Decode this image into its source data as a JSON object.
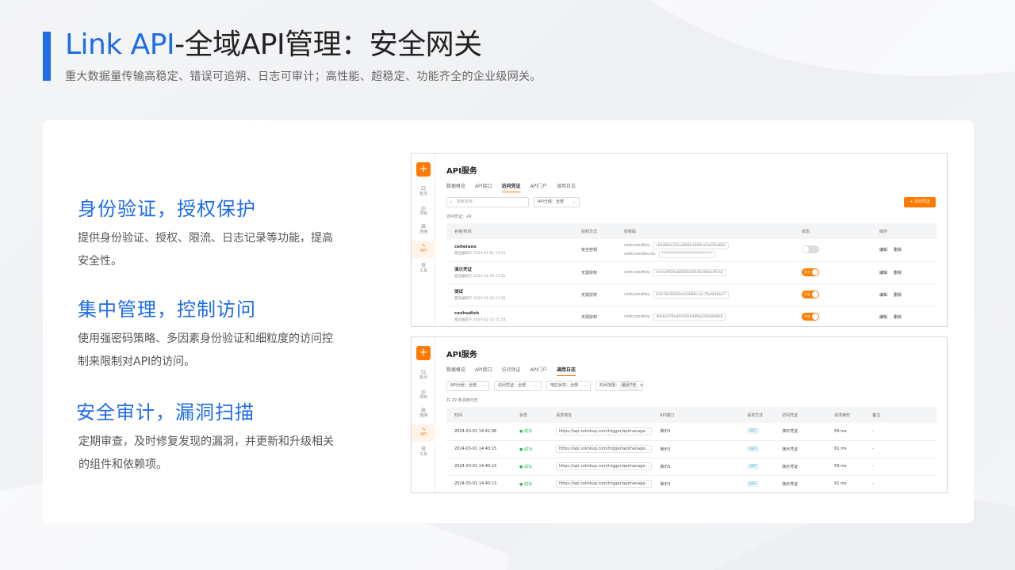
{
  "page": {
    "title_accent": "Link API",
    "title_rest": "-全域API管理：安全网关",
    "subtitle": "重大数据量传输高稳定、错误可追朔、日志可审计；高性能、超稳定、功能齐全的企业级网关。",
    "accent_color": "#1e6ce8",
    "brand_orange": "#ff7a00"
  },
  "features": [
    {
      "heading": "身份验证，授权保护",
      "body": "提供身份验证、授权、限流、日志记录等功能，提高安全性。"
    },
    {
      "heading": "集中管理，控制访问",
      "body": "使用强密码策略、多因素身份验证和细粒度的访问控制来限制对API的访问。"
    },
    {
      "heading": "安全审计，漏洞扫描",
      "body": "定期审查，及时修复发现的漏洞，并更新和升级相关的组件和依赖项。"
    }
  ],
  "rail": {
    "plus": "+",
    "items": [
      {
        "icon": "home-icon",
        "glyph": "⊡",
        "label": "首页"
      },
      {
        "icon": "project-icon",
        "glyph": "◎",
        "label": "项目"
      },
      {
        "icon": "connector-icon",
        "glyph": "⊞",
        "label": "连接"
      },
      {
        "icon": "api-icon",
        "glyph": "∿",
        "label": "API"
      },
      {
        "icon": "tools-icon",
        "glyph": "⚙",
        "label": "工具"
      }
    ]
  },
  "shot1": {
    "app_title": "API服务",
    "tabs": [
      "数据概览",
      "API接口",
      "访问凭证",
      "API门户",
      "调用日志"
    ],
    "active_tab": 2,
    "search_placeholder": "搜索名称",
    "group_filter": "API分组：全部",
    "new_button": "+ 访问凭证",
    "count": "访问凭证：24",
    "columns": [
      "名称/时间",
      "授权方式",
      "授权码",
      "状态",
      "操作"
    ],
    "rows": [
      {
        "name": "ceheiuos",
        "time": "最后编辑于 2024-03-01 14:53",
        "auth": "安全密钥",
        "key_label": "ceAccessKey:",
        "key": "c00d9fde1f3ee868b1608ca5a659e6d0",
        "secret_label": "ceAccessSecret:",
        "secret": "****************************",
        "status": "off",
        "status_text": "",
        "ops": [
          "编辑",
          "删除"
        ]
      },
      {
        "name": "演示凭证",
        "time": "最后编辑于 2024-02-29 17:56",
        "auth": "无需授权",
        "key_label": "ceAccessKey:",
        "key": "4c0eeff5f4a8496603f4db1984e0f2a0",
        "secret_label": "",
        "secret": "",
        "status": "on",
        "status_text": "开启",
        "ops": [
          "编辑",
          "删除"
        ]
      },
      {
        "name": "测试",
        "time": "最后编辑于 2024-02-22 13:56",
        "auth": "无需授权",
        "key_label": "ceAccessKey:",
        "key": "8547043602fe4d3988cc2c7fb4846b27",
        "secret_label": "",
        "secret": "",
        "status": "on",
        "status_text": "开启",
        "ops": [
          "编辑",
          "删除"
        ]
      },
      {
        "name": "ceshudish",
        "time": "最后编辑于 2024-02-22 11:54",
        "auth": "无需授权",
        "key_label": "ceAccessKey:",
        "key": "d9a8c079a404302bd8fba285b868b8",
        "secret_label": "",
        "secret": "",
        "status": "on",
        "status_text": "开启",
        "ops": [
          "编辑",
          "删除"
        ]
      }
    ]
  },
  "shot2": {
    "app_title": "API服务",
    "tabs": [
      "数据概览",
      "API接口",
      "访问凭证",
      "API门户",
      "调用日志"
    ],
    "active_tab": 4,
    "filters": [
      "API分组：全部",
      "访问凭证：全部",
      "响应状态：全部"
    ],
    "time_label": "时间范围：",
    "time_value": "最近7天",
    "count": "共 29 条调用日志",
    "columns": [
      "时间",
      "状态",
      "请求地址",
      "API接口",
      "请求方法",
      "访问凭证",
      "请求耗时",
      "备注"
    ],
    "rows": [
      {
        "time": "2024-03-01 14:41:06",
        "status": "● 成功",
        "url": "https://api.solinkup.com/trigger/apimanage...",
        "api": "演示3",
        "method": "GET",
        "cred": "演示凭证",
        "cost": "69 ms",
        "note": "-"
      },
      {
        "time": "2024-03-01 14:40:15",
        "status": "● 成功",
        "url": "https://api.solinkup.com/trigger/apimanage...",
        "api": "演示3",
        "method": "GET",
        "cred": "演示凭证",
        "cost": "61 ms",
        "note": "-"
      },
      {
        "time": "2024-03-01 14:40:14",
        "status": "● 成功",
        "url": "https://api.solinkup.com/trigger/apimanage...",
        "api": "演示3",
        "method": "GET",
        "cred": "演示凭证",
        "cost": "59 ms",
        "note": "-"
      },
      {
        "time": "2024-03-01 14:40:13",
        "status": "● 成功",
        "url": "https://api.solinkup.com/trigger/apimanage...",
        "api": "演示3",
        "method": "GET",
        "cred": "演示凭证",
        "cost": "61 ms",
        "note": "-"
      }
    ]
  }
}
